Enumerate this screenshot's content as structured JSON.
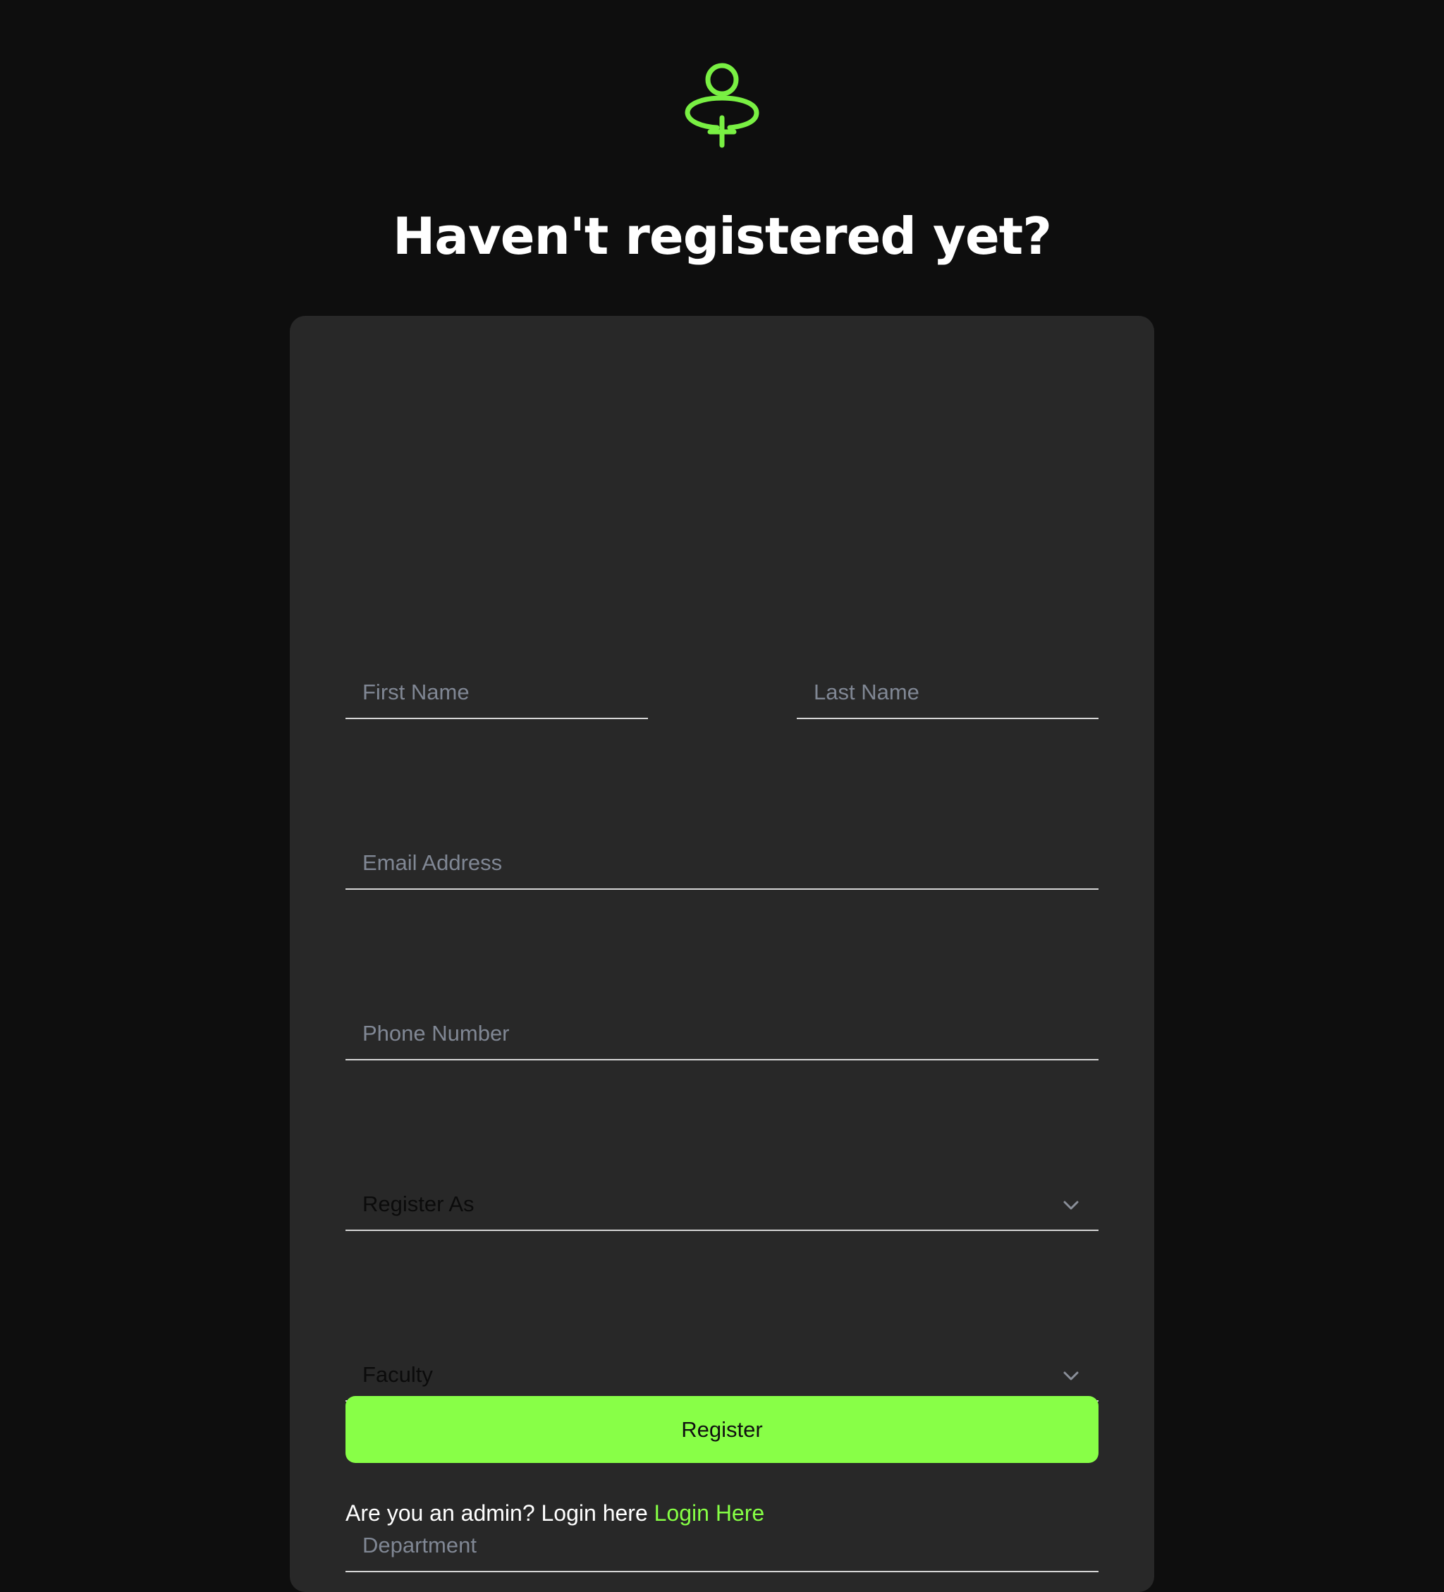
{
  "header": {
    "icon": "user-add-icon",
    "title": "Haven't registered yet?"
  },
  "form": {
    "first_name": {
      "value": "",
      "placeholder": "First Name"
    },
    "last_name": {
      "value": "",
      "placeholder": "Last Name"
    },
    "email": {
      "value": "",
      "placeholder": "Email Address"
    },
    "phone": {
      "value": "",
      "placeholder": "Phone Number"
    },
    "register_as": {
      "selected": "Register As",
      "icon": "chevron-down-icon"
    },
    "faculty": {
      "selected": "Faculty",
      "icon": "chevron-down-icon"
    },
    "department": {
      "value": "",
      "placeholder": "Department"
    },
    "submit_label": "Register"
  },
  "footer": {
    "prompt": "Are you an admin? Login here",
    "link_label": "Login Here"
  },
  "colors": {
    "background": "#0e0e0e",
    "card": "#282828",
    "accent": "#88ff47",
    "text": "#ffffff",
    "placeholder": "#808794"
  }
}
